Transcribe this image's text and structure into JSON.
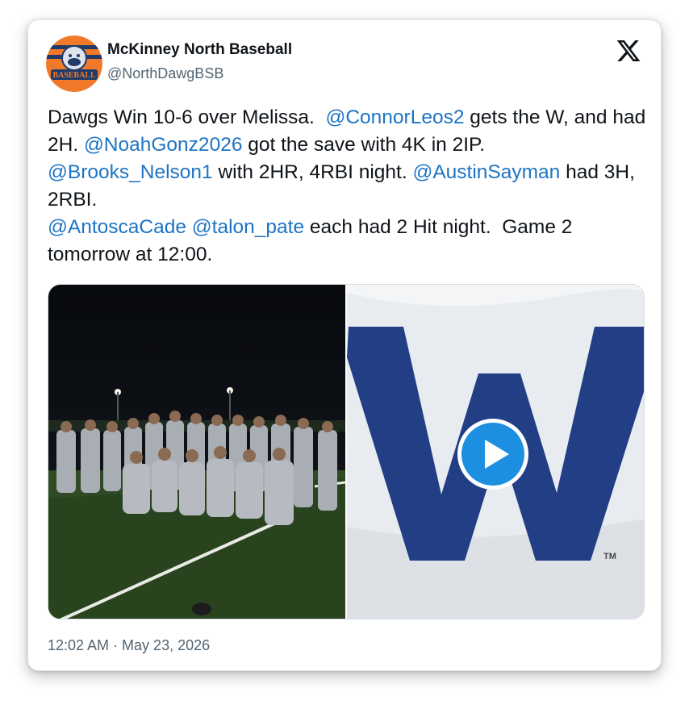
{
  "tweet": {
    "author": {
      "display_name": "McKinney North Baseball",
      "handle": "@NorthDawgBSB",
      "avatar_text": "BASEBALL"
    },
    "segments": [
      {
        "text": "Dawgs Win 10-6 over Melissa.  ",
        "mention": false
      },
      {
        "text": "@ConnorLeos2",
        "mention": true
      },
      {
        "text": " gets the W, and had 2H. ",
        "mention": false
      },
      {
        "text": "@NoahGonz2026",
        "mention": true
      },
      {
        "text": " got the save with 4K in 2IP. ",
        "mention": false
      },
      {
        "text": "@Brooks_Nelson1",
        "mention": true
      },
      {
        "text": " with 2HR, 4RBI night. ",
        "mention": false
      },
      {
        "text": "@AustinSayman",
        "mention": true
      },
      {
        "text": " had 3H, 2RBI.\n",
        "mention": false
      },
      {
        "text": "@AntoscaCade",
        "mention": true
      },
      {
        "text": " ",
        "mention": false
      },
      {
        "text": "@talon_pate",
        "mention": true
      },
      {
        "text": " each had 2 Hit night.  Game 2 tomorrow at 12:00.",
        "mention": false
      }
    ],
    "media": {
      "left_alt": "team-photo",
      "right_letter": "W",
      "right_tm": "TM"
    },
    "timestamp": "12:02 AM · May 23, 2026"
  },
  "colors": {
    "mention": "#1d74c4",
    "w_flag_blue": "#223e85",
    "play_button": "#1d8fe0",
    "text": "#0f1419",
    "muted": "#536471"
  },
  "icons": {
    "brand": "x-logo-icon",
    "play": "play-icon"
  }
}
